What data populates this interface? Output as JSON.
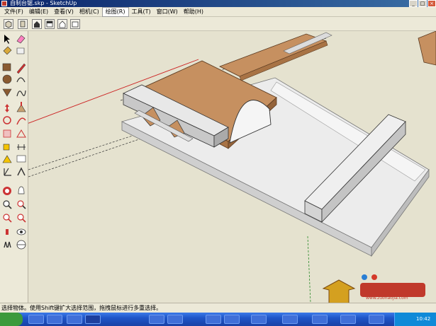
{
  "window": {
    "title": "自制台锯.skp - SketchUp",
    "buttons": {
      "minimize": "_",
      "maximize": "□",
      "close": "×"
    }
  },
  "menu": {
    "items": [
      {
        "label": "文件(F)"
      },
      {
        "label": "编辑(E)"
      },
      {
        "label": "查看(V)"
      },
      {
        "label": "相机(C)"
      },
      {
        "label": "绘图(R)",
        "active": true
      },
      {
        "label": "工具(T)"
      },
      {
        "label": "窗口(W)"
      },
      {
        "label": "帮助(H)"
      }
    ]
  },
  "top_toolbar": {
    "icons": [
      "iso-view-icon",
      "front-view-icon",
      "home-view-icon",
      "top-view-icon",
      "house-view-icon",
      "side-view-icon"
    ]
  },
  "left_toolbar": {
    "tools": [
      "select-icon",
      "eraser-icon",
      "rectangle-icon",
      "pencil-icon",
      "circle-icon",
      "arc-icon",
      "polygon-icon",
      "freehand-icon",
      "move-icon",
      "push-pull-icon",
      "rotate-icon",
      "follow-me-icon",
      "scale-icon",
      "offset-icon",
      "tape-measure-icon",
      "dimension-icon",
      "protractor-icon",
      "text-icon",
      "axes-icon",
      "3d-text-icon",
      "paint-bucket-icon",
      "orbit-icon",
      "pan-icon",
      "zoom-icon",
      "zoom-window-icon",
      "zoom-extents-icon",
      "previous-view-icon",
      "next-view-icon",
      "position-camera-icon",
      "walk-icon",
      "look-around-icon",
      "section-plane-icon"
    ]
  },
  "status": {
    "text": "选择物体。使用Shift键扩大选择范围，拖拽鼠标进行多重选择。"
  },
  "taskbar": {
    "clock": "10:42"
  },
  "watermark": {
    "site": "www.zuohaojia.com"
  },
  "colors": {
    "wood": "#c69060",
    "wood_dark": "#a87345",
    "panel": "#e6e6e6",
    "viewport_bg": "#e5e2cf",
    "axis_red": "#cc2222",
    "title_bar": "#0a246a"
  }
}
